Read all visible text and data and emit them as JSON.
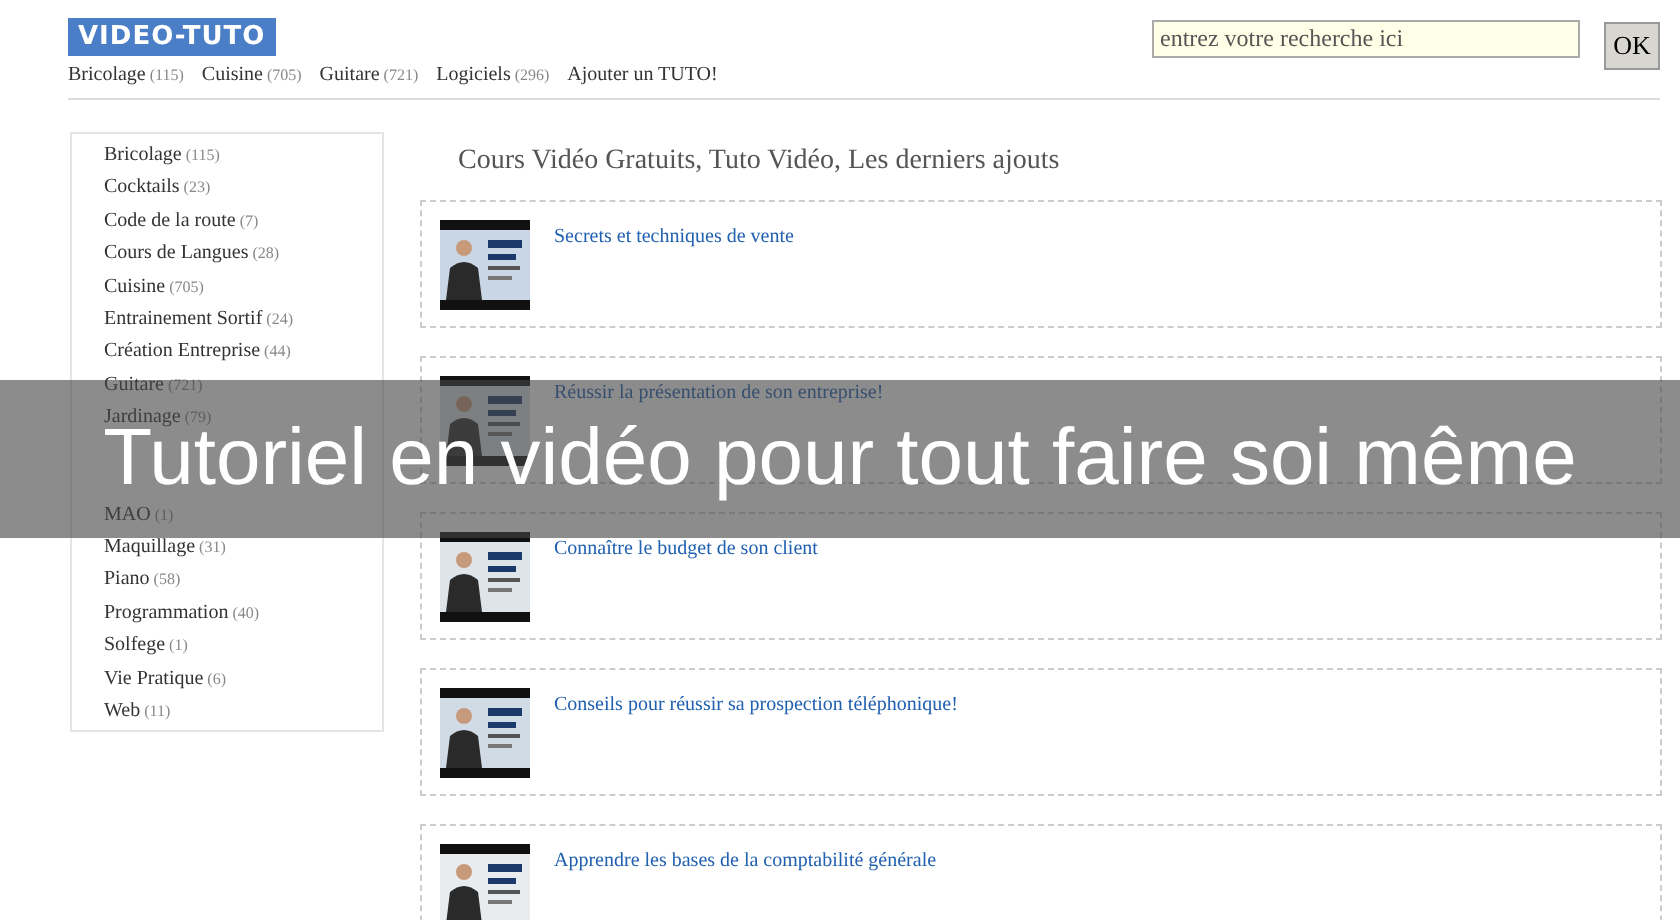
{
  "header": {
    "logo": "VIDEO-TUTO",
    "nav": [
      {
        "label": "Bricolage",
        "count": "(115)"
      },
      {
        "label": "Cuisine",
        "count": "(705)"
      },
      {
        "label": "Guitare",
        "count": "(721)"
      },
      {
        "label": "Logiciels",
        "count": "(296)"
      },
      {
        "label": "Ajouter un TUTO!"
      }
    ],
    "search": {
      "placeholder": "entrez votre recherche ici",
      "button": "OK"
    }
  },
  "sidebar": {
    "groups": [
      [
        {
          "label": "Bricolage",
          "count": "(115)"
        },
        {
          "label": "Cocktails",
          "count": "(23)"
        },
        {
          "label": "Code de la route",
          "count": "(7)"
        },
        {
          "label": "Cours de Langues",
          "count": "(28)"
        },
        {
          "label": "Cuisine",
          "count": "(705)"
        },
        {
          "label": "Entrainement Sortif",
          "count": "(24)"
        },
        {
          "label": "Création Entreprise",
          "count": "(44)"
        },
        {
          "label": "Guitare",
          "count": "(721)"
        },
        {
          "label": "Jardinage",
          "count": "(79)"
        }
      ],
      [
        {
          "label": "MAO",
          "count": "(1)"
        },
        {
          "label": "Maquillage",
          "count": "(31)"
        },
        {
          "label": "Piano",
          "count": "(58)"
        },
        {
          "label": "Programmation",
          "count": "(40)"
        },
        {
          "label": "Solfege",
          "count": "(1)"
        },
        {
          "label": "Vie Pratique",
          "count": "(6)"
        },
        {
          "label": "Web",
          "count": "(11)"
        }
      ]
    ]
  },
  "main": {
    "heading": "Cours Vidéo Gratuits, Tuto Vidéo, Les derniers ajouts",
    "videos": [
      {
        "title": "Secrets et techniques de vente"
      },
      {
        "title": "Réussir la présentation de son entreprise!"
      },
      {
        "title": "Connaître le budget de son client"
      },
      {
        "title": "Conseils pour réussir sa prospection téléphonique!"
      },
      {
        "title": "Apprendre les bases de la comptabilité générale"
      }
    ]
  },
  "banner": {
    "text": "Tutoriel en vidéo pour tout faire soi même"
  }
}
